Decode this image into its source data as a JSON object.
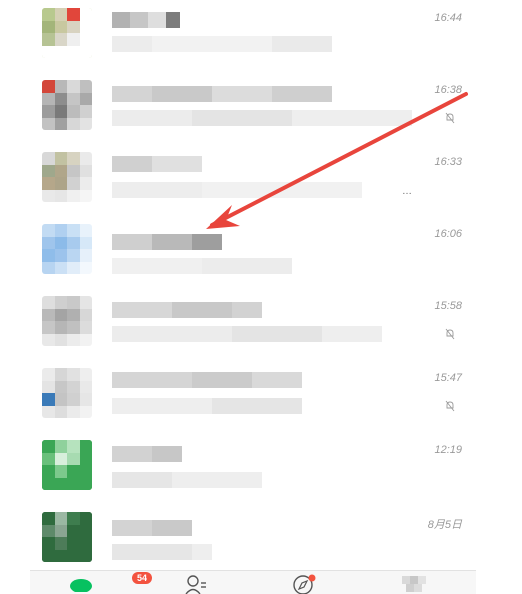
{
  "chats": [
    {
      "time": "16:44",
      "muted": false
    },
    {
      "time": "16:38",
      "muted": true
    },
    {
      "time": "16:33",
      "muted": false,
      "dots": "…"
    },
    {
      "time": "16:06",
      "muted": false
    },
    {
      "time": "15:58",
      "muted": true
    },
    {
      "time": "15:47",
      "muted": true
    },
    {
      "time": "12:19",
      "muted": false
    },
    {
      "time": "8月5日",
      "muted": false
    }
  ],
  "tabbar": {
    "chats_badge": "54",
    "items": [
      "chats-tab-icon",
      "contacts-tab-icon",
      "discover-tab-icon",
      "me-tab-icon"
    ]
  },
  "annotation": {
    "color": "#e8453c"
  },
  "colors": {
    "accent": "#07c160",
    "badge": "#f3533f"
  }
}
